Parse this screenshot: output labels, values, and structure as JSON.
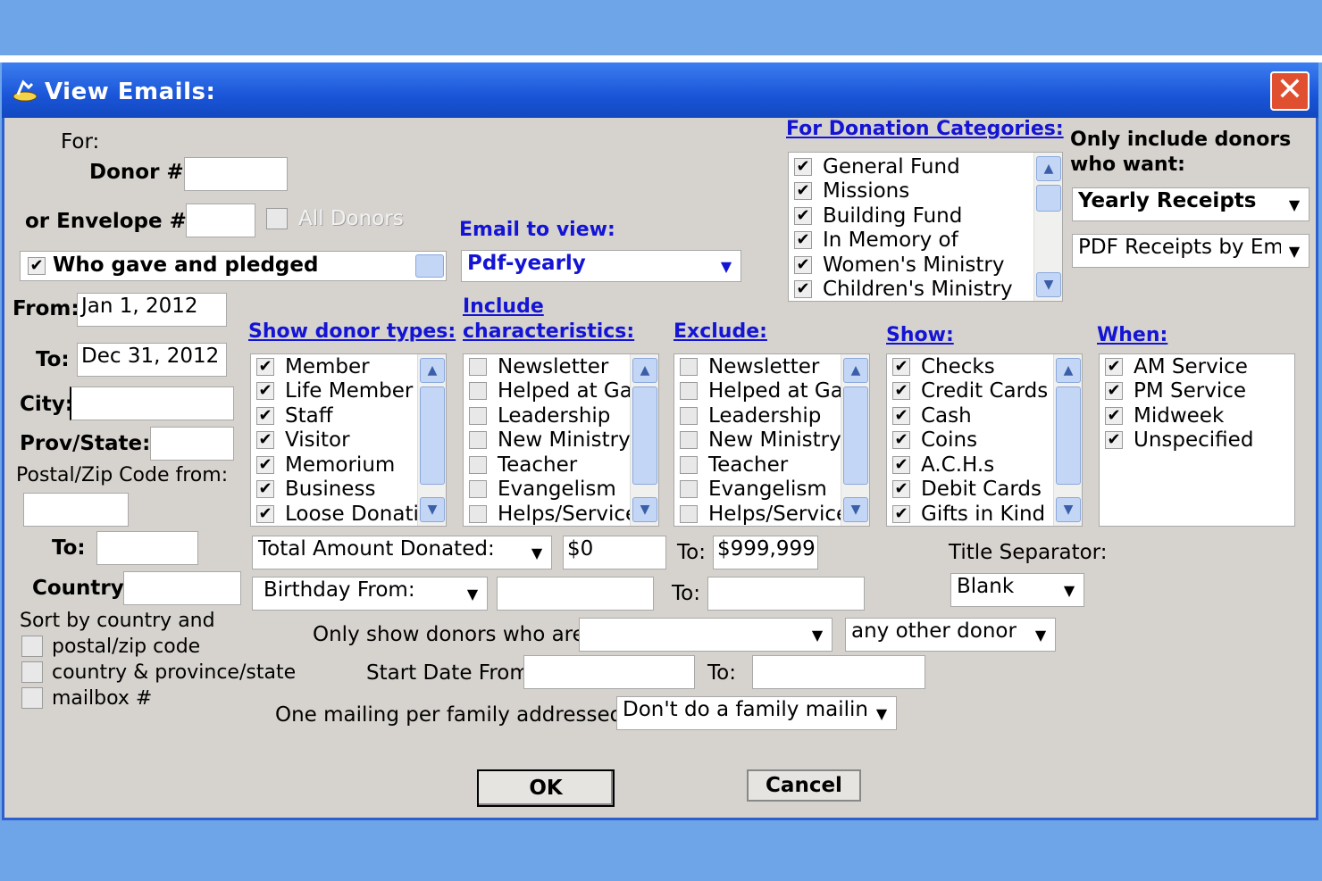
{
  "window": {
    "title": "View Emails:",
    "close_symbol": "✕"
  },
  "filters": {
    "for_label": "For:",
    "donor_label": "Donor #:",
    "donor_value": "",
    "envelope_label": "or Envelope #:",
    "envelope_value": "",
    "all_donors_label": "All Donors",
    "who_gave_label": "Who gave and pledged",
    "from_label": "From:",
    "from_value": "Jan 1, 2012",
    "to_label": "To:",
    "to_value": "Dec 31, 2012",
    "city_label": "City:",
    "city_value": "",
    "prov_label": "Prov/State:",
    "prov_value": "",
    "postal_from_label": "Postal/Zip Code from:",
    "postal_from_value": "",
    "postal_to_label": "To:",
    "postal_to_value": "",
    "country_label": "Country:",
    "country_value": "",
    "sort_label": "Sort by country and",
    "sort_options": [
      "postal/zip code",
      "country & province/state",
      "mailbox #"
    ]
  },
  "email_to_view": {
    "label": "Email to view:",
    "value": "Pdf-yearly"
  },
  "donation_categories": {
    "label": "For Donation Categories:",
    "items": [
      "General Fund",
      "Missions",
      "Building Fund",
      "In Memory of",
      "Women's Ministry",
      "Children's Ministry"
    ]
  },
  "only_include": {
    "label_line1": "Only include donors",
    "label_line2": "who want:",
    "value": "Yearly Receipts",
    "value2": "PDF Receipts by Ema"
  },
  "donor_types": {
    "label": "Show donor types:",
    "items": [
      "Member",
      "Life Member",
      "Staff",
      "Visitor",
      "Memorium",
      "Business",
      "Loose Donatic"
    ]
  },
  "characteristics": {
    "label_line1": "Include",
    "label_line2": "characteristics:",
    "items": [
      "Newsletter",
      "Helped at Gala",
      "Leadership",
      "New Ministry D",
      "Teacher",
      "Evangelism",
      "Helps/Service"
    ]
  },
  "exclude": {
    "label": "Exclude:",
    "items": [
      "Newsletter",
      "Helped at Gala",
      "Leadership",
      "New Ministry D",
      "Teacher",
      "Evangelism",
      "Helps/Service"
    ]
  },
  "show": {
    "label": "Show:",
    "items": [
      "Checks",
      "Credit Cards",
      "Cash",
      "Coins",
      "A.C.H.s",
      "Debit Cards",
      "Gifts in Kind"
    ]
  },
  "when": {
    "label": "When:",
    "items": [
      "AM Service",
      "PM Service",
      "Midweek",
      "Unspecified"
    ]
  },
  "amount": {
    "select": "Total Amount Donated:",
    "from_value": "$0",
    "to_label": "To:",
    "to_value": "$999,999"
  },
  "birthday": {
    "select": "Birthday From:",
    "from_value": "",
    "to_label": "To:",
    "to_value": ""
  },
  "title_separator": {
    "label": "Title Separator:",
    "value": "Blank"
  },
  "only_show": {
    "label": "Only show donors who are a:",
    "value": "",
    "value2": "any other donor"
  },
  "start_date": {
    "label": "Start Date From:",
    "from_value": "",
    "to_label": "To:",
    "to_value": ""
  },
  "family_mailing": {
    "label": "One mailing per family addressed to:",
    "value": "Don't do a family mailing"
  },
  "buttons": {
    "ok": "OK",
    "cancel": "Cancel"
  },
  "glyphs": {
    "check": "✔",
    "arrow_down": "▼",
    "arrow_up": "▲"
  },
  "colors": {
    "title_bar": "#1a55d8",
    "link": "#1414d4",
    "background": "#d6d3ce",
    "desktop": "#6ea5e9"
  }
}
